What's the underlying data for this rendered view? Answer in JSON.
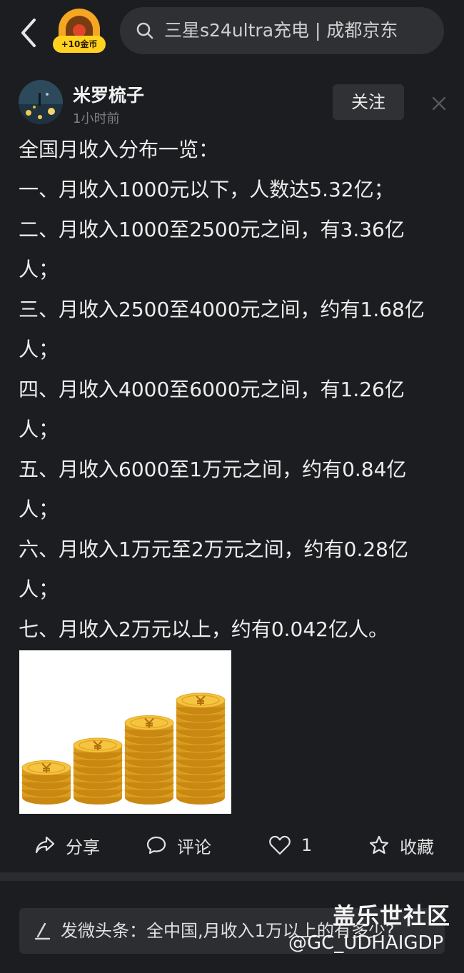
{
  "topbar": {
    "coin_reward": "+10金币",
    "search_text": "三星s24ultra充电 | 成都京东"
  },
  "author": {
    "name": "米罗梳子",
    "time": "1小时前",
    "follow_label": "关注"
  },
  "post": {
    "lines": [
      "全国月收入分布一览：",
      "一、月收入1000元以下，人数达5.32亿；",
      "二、月收入1000至2500元之间，有3.36亿",
      "人；",
      "三、月收入2500至4000元之间，约有1.68亿",
      "人；",
      "四、月收入4000至6000元之间，有1.26亿",
      "人；",
      "五、月收入6000至1万元之间，约有0.84亿",
      "人；",
      "六、月收入1万元至2万元之间，约有0.28亿",
      "人；",
      "七、月收入2万元以上，约有0.042亿人。"
    ],
    "image_icon": "coin-stacks"
  },
  "actions": {
    "share_label": "分享",
    "comment_label": "评论",
    "like_count": "1",
    "collect_label": "收藏"
  },
  "bottom": {
    "comment_prompt": "发微头条：全中国,月收入1万以上的有多少?"
  },
  "watermark": {
    "site": "盖乐世社区",
    "handle": "@GC_UDHAIGDP"
  },
  "colors": {
    "background": "#1b1d20",
    "coin_gold": "#f5c542",
    "badge_yellow": "#ffd21f"
  }
}
